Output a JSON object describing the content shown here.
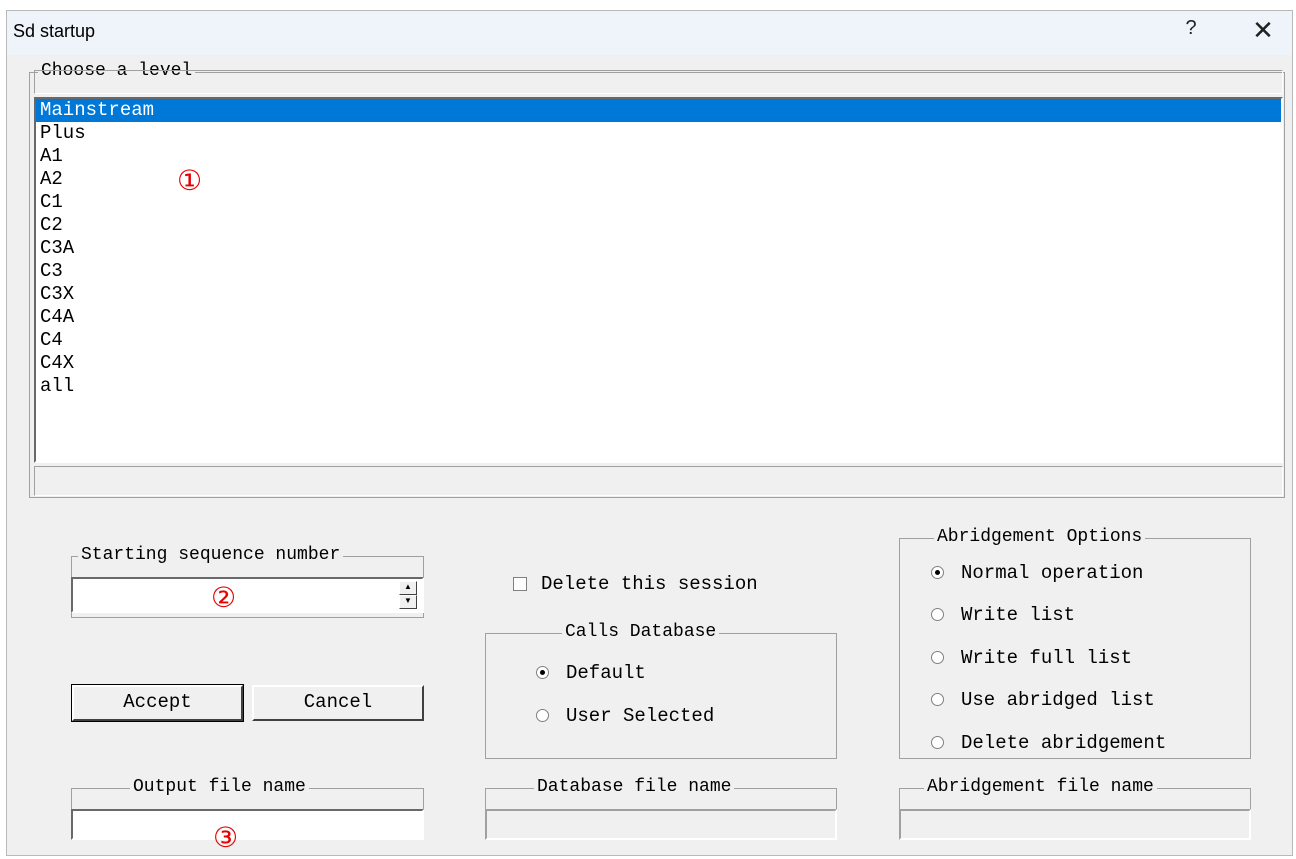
{
  "window": {
    "title": "Sd startup",
    "help_label": "?",
    "close_label": "✕"
  },
  "levels": {
    "group_label": "Choose a level",
    "items": [
      "Mainstream",
      "Plus",
      "A1",
      "A2",
      "C1",
      "C2",
      "C3A",
      "C3",
      "C3X",
      "C4A",
      "C4",
      "C4X",
      "all"
    ],
    "selected": "Mainstream"
  },
  "annotations": {
    "one": "①",
    "two": "②",
    "three": "③"
  },
  "sequence": {
    "label": "Starting sequence number",
    "value": ""
  },
  "buttons": {
    "accept": "Accept",
    "cancel": "Cancel"
  },
  "output": {
    "label": "Output file name",
    "value": ""
  },
  "delete_session": {
    "label": "Delete this session",
    "checked": false
  },
  "calls_db": {
    "label": "Calls Database",
    "options": [
      "Default",
      "User Selected"
    ],
    "selected": "Default"
  },
  "database_file": {
    "label": "Database file name",
    "value": ""
  },
  "abridgement": {
    "label": "Abridgement Options",
    "options": [
      "Normal operation",
      "Write list",
      "Write full list",
      "Use abridged list",
      "Delete abridgement"
    ],
    "selected": "Normal operation"
  },
  "abridgement_file": {
    "label": "Abridgement file name",
    "value": ""
  },
  "colors": {
    "selection": "#0078d7",
    "annotation": "#e60000",
    "dialog_bg": "#f0f0f0",
    "titlebar_bg": "#eef4fa"
  }
}
